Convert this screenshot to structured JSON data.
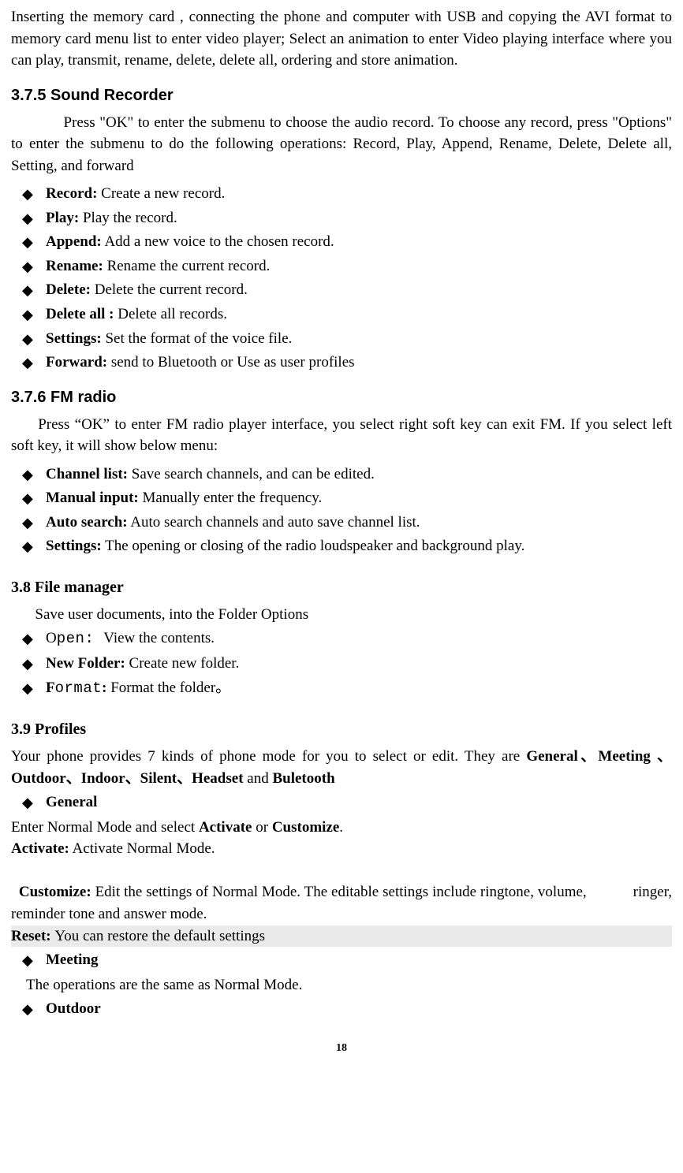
{
  "intro_paragraph": "Inserting the memory card , connecting the phone and computer with USB and copying the AVI format to memory card menu list to enter video player; Select an animation to enter Video playing interface where you can play, transmit, rename, delete, delete all, ordering and store animation.",
  "sound_recorder": {
    "heading": "3.7.5 Sound Recorder",
    "intro": "Press \"OK\" to enter the submenu to choose the audio record. To choose any record, press \"Options\" to enter the submenu to do the following operations: Record, Play, Append, Rename, Delete, Delete all, Setting, and forward",
    "items": [
      {
        "label": "Record:",
        "text": " Create a new record."
      },
      {
        "label": "Play:",
        "text": " Play the record."
      },
      {
        "label": "Append:",
        "text": " Add a new voice to the chosen record."
      },
      {
        "label": "Rename:",
        "text": " Rename the current record."
      },
      {
        "label": "Delete:",
        "text": " Delete the current record."
      },
      {
        "label": "Delete all :",
        "text": " Delete all records."
      },
      {
        "label": "Settings:",
        "text": " Set the format of the voice file."
      },
      {
        "label": "Forward:",
        "text": " send to Bluetooth or Use as user profiles"
      }
    ]
  },
  "fm_radio": {
    "heading": "3.7.6 FM radio",
    "intro": "Press “OK” to enter FM radio player interface, you select right soft key can exit FM. If you select left soft key, it will show below menu:",
    "items": [
      {
        "label": "Channel list:",
        "text": " Save search channels, and can be edited."
      },
      {
        "label": "Manual input:",
        "text": " Manually enter the frequency."
      },
      {
        "label": "Auto search:",
        "text": " Auto search channels and auto save channel list."
      },
      {
        "label": "Settings:",
        "text": " The opening or closing of the radio loudspeaker and background play."
      }
    ]
  },
  "file_manager": {
    "heading": "3.8 File manager",
    "intro": "Save user documents, into the Folder Options",
    "items": [
      {
        "label_pre": "O",
        "label_mono": "pen: ",
        "label_post": "",
        "text": "View the contents."
      },
      {
        "label_pre": "",
        "label_mono": "",
        "label_post": "New Folder:",
        "text": " Create new folder."
      },
      {
        "label_pre": "F",
        "label_mono": "ormat",
        "label_post": ":",
        "text": " Format the folder。"
      }
    ]
  },
  "profiles": {
    "heading": "3.9 Profiles",
    "intro_text_1": "Your phone provides 7 kinds of phone mode for you to select or edit. They are ",
    "intro_bold_list": "General、Meeting 、Outdoor、Indoor、Silent、Headset",
    "intro_and": " and ",
    "intro_last": "Buletooth",
    "general": {
      "label": "General",
      "line1_pre": "Enter Normal Mode and select ",
      "line1_b1": "Activate",
      "line1_mid": " or ",
      "line1_b2": "Customize",
      "line1_end": ".",
      "activate_label": "Activate:",
      "activate_text": " Activate Normal Mode.",
      "customize_label": "Customize:",
      "customize_text": " Edit the settings of Normal Mode. The editable settings include ringtone, volume,            ringer, reminder tone and answer mode.",
      "reset_label": "Reset: ",
      "reset_text": "You can restore the default settings"
    },
    "meeting": {
      "label": "Meeting",
      "text": "The operations are the same as Normal Mode."
    },
    "outdoor": {
      "label": "Outdoor"
    }
  },
  "page_number": "18",
  "icons": {
    "diamond": "◆"
  }
}
